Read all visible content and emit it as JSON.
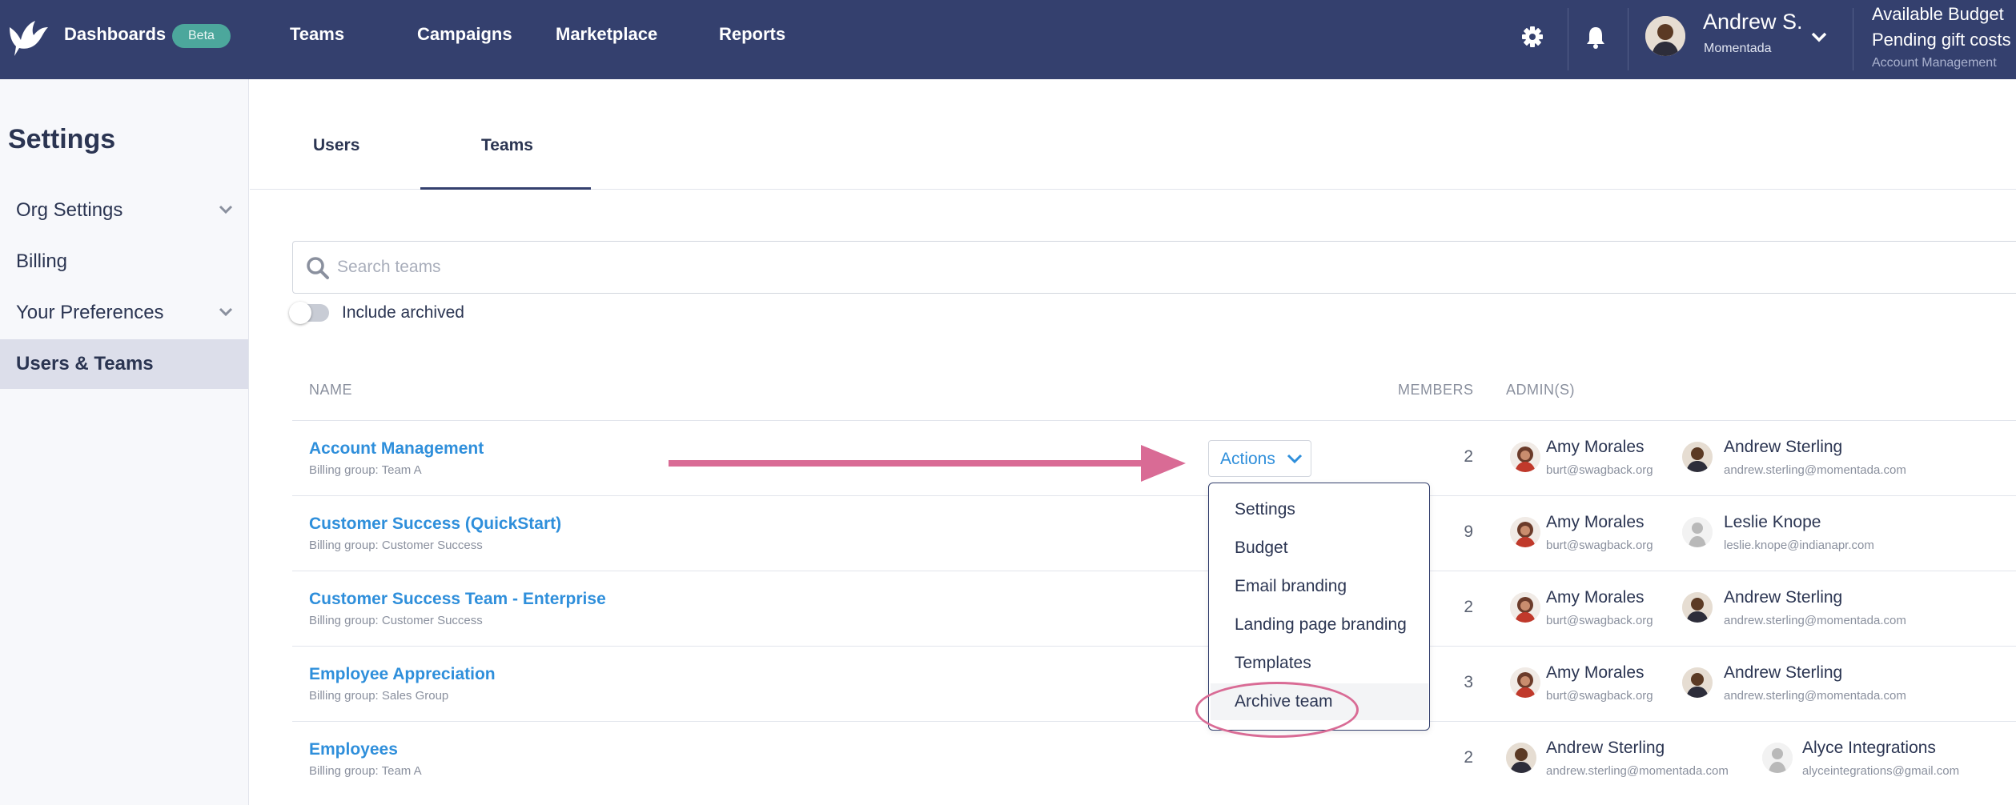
{
  "topbar": {
    "nav": [
      "Dashboards",
      "Teams",
      "Campaigns",
      "Marketplace",
      "Reports"
    ],
    "beta_badge": "Beta",
    "user": {
      "name": "Andrew S.",
      "org": "Momentada"
    },
    "budget": {
      "line1": "Available Budget",
      "line2": "Pending gift costs",
      "team": "Account Management"
    }
  },
  "sidebar": {
    "title": "Settings",
    "items": [
      {
        "label": "Org Settings",
        "expandable": true
      },
      {
        "label": "Billing",
        "expandable": false
      },
      {
        "label": "Your Preferences",
        "expandable": true
      },
      {
        "label": "Users & Teams",
        "active": true
      }
    ]
  },
  "tabs": [
    {
      "label": "Users",
      "active": false
    },
    {
      "label": "Teams",
      "active": true
    }
  ],
  "search": {
    "placeholder": "Search teams",
    "value": ""
  },
  "include_archived": {
    "label": "Include archived",
    "on": false
  },
  "table": {
    "headers": {
      "name": "NAME",
      "members": "MEMBERS",
      "admins": "ADMIN(S)"
    },
    "rows": [
      {
        "name": "Account Management",
        "billing": "Billing group: Team A",
        "members": "2",
        "admins": [
          {
            "name": "Amy Morales",
            "email": "burt@swagback.org",
            "avatar": "woman-avatar"
          },
          {
            "name": "Andrew Sterling",
            "email": "andrew.sterling@momentada.com",
            "avatar": "man-avatar"
          }
        ]
      },
      {
        "name": "Customer Success (QuickStart)",
        "billing": "Billing group: Customer Success",
        "members": "9",
        "admins": [
          {
            "name": "Amy Morales",
            "email": "burt@swagback.org",
            "avatar": "woman-avatar"
          },
          {
            "name": "Leslie Knope",
            "email": "leslie.knope@indianapr.com",
            "avatar": "default-avatar"
          }
        ]
      },
      {
        "name": "Customer Success Team - Enterprise",
        "billing": "Billing group: Customer Success",
        "members": "2",
        "admins": [
          {
            "name": "Amy Morales",
            "email": "burt@swagback.org",
            "avatar": "woman-avatar"
          },
          {
            "name": "Andrew Sterling",
            "email": "andrew.sterling@momentada.com",
            "avatar": "man-avatar"
          }
        ]
      },
      {
        "name": "Employee Appreciation",
        "billing": "Billing group: Sales Group",
        "members": "3",
        "admins": [
          {
            "name": "Amy Morales",
            "email": "burt@swagback.org",
            "avatar": "woman-avatar"
          },
          {
            "name": "Andrew Sterling",
            "email": "andrew.sterling@momentada.com",
            "avatar": "man-avatar"
          }
        ]
      },
      {
        "name": "Employees",
        "billing": "Billing group: Team A",
        "members": "2",
        "admins": [
          {
            "name": "Andrew Sterling",
            "email": "andrew.sterling@momentada.com",
            "avatar": "man-avatar"
          },
          {
            "name": "Alyce Integrations",
            "email": "alyceintegrations@gmail.com",
            "avatar": "default-avatar"
          }
        ]
      }
    ]
  },
  "actions": {
    "label": "Actions",
    "menu": [
      "Settings",
      "Budget",
      "Email branding",
      "Landing page branding",
      "Templates",
      "Archive team"
    ],
    "highlighted": "Archive team"
  },
  "colors": {
    "topbar": "#34406e",
    "link": "#2f8fdb",
    "annotation": "#d96b95",
    "beta": "#4ca79c"
  }
}
